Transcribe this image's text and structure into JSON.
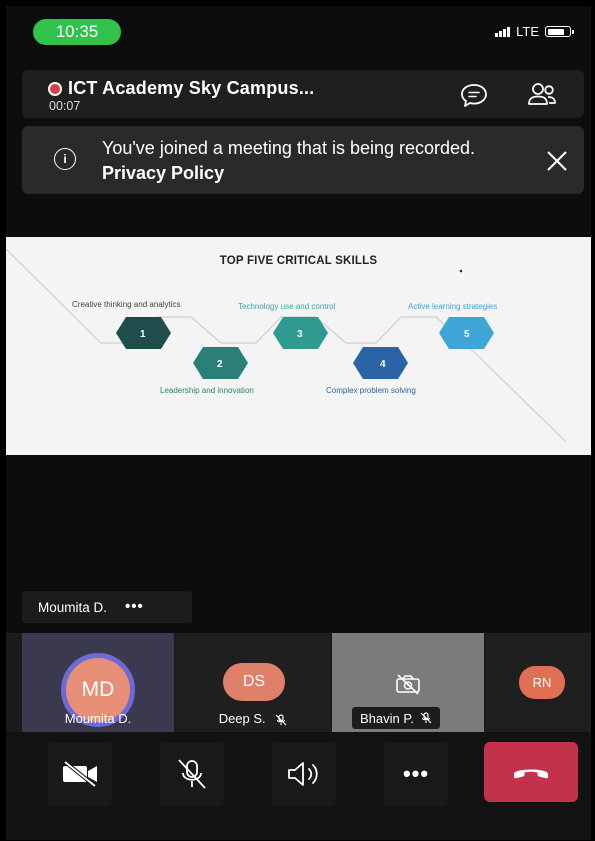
{
  "status_bar": {
    "time": "10:35",
    "network": "LTE"
  },
  "meeting": {
    "title": "ICT Academy Sky Campus...",
    "timer": "00:07"
  },
  "banner": {
    "text": "You've joined a meeting that is being recorded.",
    "link": "Privacy Policy"
  },
  "slide": {
    "title": "TOP FIVE CRITICAL SKILLS",
    "skills": [
      {
        "num": "1",
        "label": "Creative thinking and analytics",
        "color": "#1f4d4b"
      },
      {
        "num": "2",
        "label": "Leadership and innovation",
        "color": "#2b7f78"
      },
      {
        "num": "3",
        "label": "Technology use and control",
        "color": "#2f9a8f"
      },
      {
        "num": "4",
        "label": "Complex problem solving",
        "color": "#2a63a6"
      },
      {
        "num": "5",
        "label": "Active learning strategies",
        "color": "#3da6d6"
      }
    ],
    "label_colors": {
      "skill3": "#3aa89d",
      "skill5": "#3da6d6",
      "skill4": "#2a63a6",
      "skill2": "#2b7f78"
    }
  },
  "presenter": {
    "name": "Moumita D.",
    "more": "•••"
  },
  "participants": [
    {
      "initials": "MD",
      "name": "Moumita D.",
      "color": "#e88f78"
    },
    {
      "initials": "DS",
      "name": "Deep S.",
      "color": "#e0806a"
    },
    {
      "initials": "",
      "name": "Bhavin P.",
      "color": "#7b7b7b"
    },
    {
      "initials": "RN",
      "name": "",
      "color": "#e06f54"
    }
  ],
  "controls": {
    "video": "video-off-icon",
    "mic": "mic-off-icon",
    "speaker": "speaker-icon",
    "more": "•••",
    "leave": "hang-up-icon",
    "leave_color": "#c4314b"
  }
}
